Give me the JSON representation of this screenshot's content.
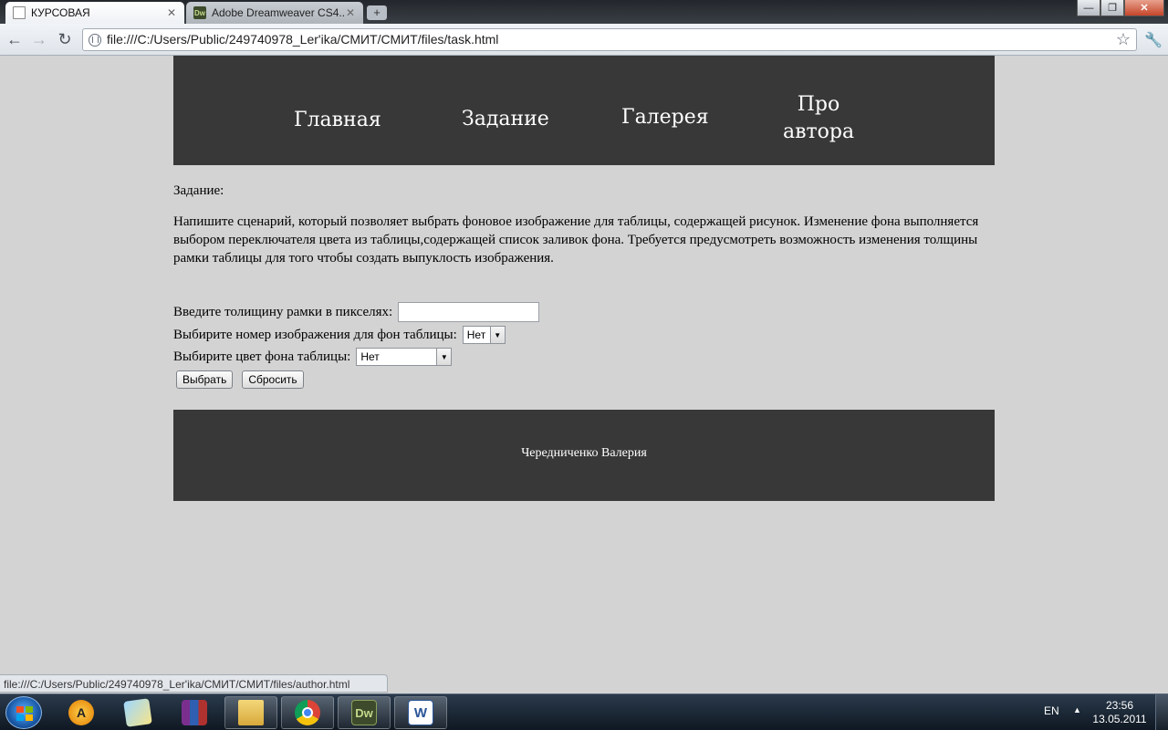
{
  "browser": {
    "tabs": [
      {
        "title": "КУРСОВАЯ",
        "close": "✕"
      },
      {
        "title": "Adobe Dreamweaver CS4...",
        "close": "✕"
      }
    ],
    "dw_label": "Dw",
    "new_tab": "+",
    "window": {
      "minimize": "—",
      "restore": "❐",
      "close": "✕"
    },
    "nav": {
      "back": "←",
      "forward": "→",
      "reload": "↻"
    },
    "url": "file:///C:/Users/Public/249740978_Ler'ika/СМИТ/СМИТ/files/task.html",
    "star": "☆",
    "wrench": "🔧",
    "status_url": "file:///C:/Users/Public/249740978_Ler'ika/СМИТ/СМИТ/files/author.html"
  },
  "page": {
    "nav": {
      "home": "Главная",
      "task": "Задание",
      "gallery": "Галерея",
      "about_line1": "Про",
      "about_line2": "автора"
    },
    "task_label": "Задание:",
    "task_text": "Напишите сценарий, который позволяет выбрать фоновое изображение для таблицы, содержащей рисунок. Изменение фона выполняется выбором переключателя цвета из таблицы,содержащей список заливок фона. Требуется предусмотреть возможность изменения толщины рамки таблицы для того чтобы создать выпуклость изображения.",
    "form": {
      "border_label": "Введите толищину рамки в пикселях:",
      "border_value": "",
      "image_label": "Выбирите номер изображения для фон таблицы:",
      "image_selected": "Нет",
      "color_label": "Выбирите цвет фона таблицы:",
      "color_selected": "Нет",
      "select_arrow": "▼",
      "submit": "Выбрать",
      "reset": "Сбросить"
    },
    "footer": "Чередниченко Валерия"
  },
  "taskbar": {
    "aimp_label": "A",
    "dw_label": "Dw",
    "word_label": "W",
    "lang": "EN",
    "tray_arrow": "▲",
    "time": "23:56",
    "date": "13.05.2011"
  }
}
